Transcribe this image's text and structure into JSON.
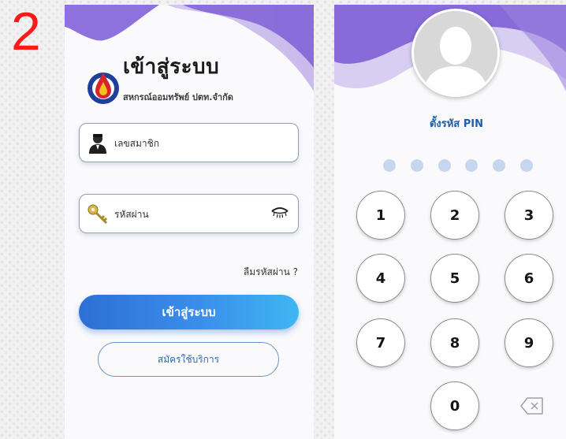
{
  "step_number": "2",
  "login": {
    "title": "เข้าสู่ระบบ",
    "subtitle": "สหกรณ์ออมทรัพย์ ปตท.จำกัด",
    "member_field_label": "เลขสมาชิก",
    "password_field_label": "รหัสผ่าน",
    "forgot_password": "ลืมรหัสผ่าน ?",
    "login_button": "เข้าสู่ระบบ",
    "register_button": "สมัครใช้บริการ"
  },
  "pin": {
    "title": "ตั้งรหัส PIN",
    "dots_count": 6,
    "keys": [
      "1",
      "2",
      "3",
      "4",
      "5",
      "6",
      "7",
      "8",
      "9",
      "0"
    ]
  },
  "colors": {
    "accent_blue": "#2d6fd6",
    "wave_purple": "#7f5fd6",
    "step_red": "#ff1a1a"
  },
  "icons": [
    "logo-icon",
    "member-icon",
    "key-icon",
    "eye-icon",
    "user-avatar-icon",
    "backspace-icon"
  ]
}
